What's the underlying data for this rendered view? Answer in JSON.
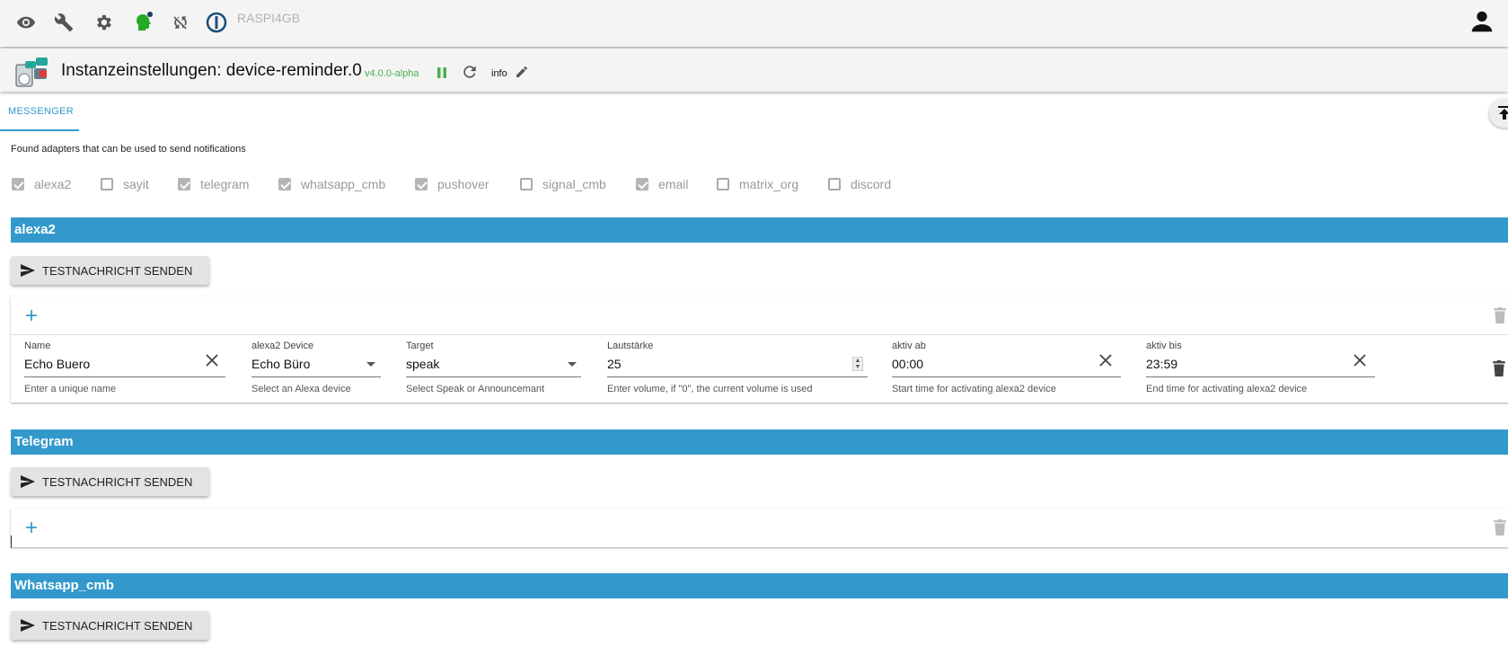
{
  "topbar": {
    "icons": [
      "eye-icon",
      "wrench-icon",
      "gear-icon",
      "head-icon",
      "sync-off-icon",
      "iobroker-logo-icon",
      "account-icon"
    ],
    "host": "RASPI4GB"
  },
  "titlebar": {
    "title": "Instanzeinstellungen: device-reminder.0",
    "version": "v4.0.0-alpha",
    "info": "info"
  },
  "tabs": [
    {
      "label": "MESSENGER"
    }
  ],
  "found_text": "Found adapters that can be used to send notifications",
  "adapters": [
    {
      "label": "alexa2",
      "checked": true
    },
    {
      "label": "sayit",
      "checked": false
    },
    {
      "label": "telegram",
      "checked": true
    },
    {
      "label": "whatsapp_cmb",
      "checked": true
    },
    {
      "label": "pushover",
      "checked": true
    },
    {
      "label": "signal_cmb",
      "checked": false
    },
    {
      "label": "email",
      "checked": true
    },
    {
      "label": "matrix_org",
      "checked": false
    },
    {
      "label": "discord",
      "checked": false
    }
  ],
  "sections": {
    "alexa2": {
      "title": "alexa2",
      "button": "TESTNACHRICHT SENDEN",
      "row": {
        "name": {
          "label": "Name",
          "value": "Echo Buero",
          "help": "Enter a unique name"
        },
        "device": {
          "label": "alexa2 Device",
          "value": "Echo Büro",
          "help": "Select an Alexa device"
        },
        "target": {
          "label": "Target",
          "value": "speak",
          "help": "Select Speak or Announcemant"
        },
        "volume": {
          "label": "Lautstärke",
          "value": "25",
          "help": "Enter volume, if \"0\", the current volume is used"
        },
        "active_from": {
          "label": "aktiv ab",
          "value": "00:00",
          "help": "Start time for activating alexa2 device"
        },
        "active_to": {
          "label": "aktiv bis",
          "value": "23:59",
          "help": "End time for activating alexa2 device"
        }
      }
    },
    "telegram": {
      "title": "Telegram",
      "button": "TESTNACHRICHT SENDEN"
    },
    "whatsapp": {
      "title": "Whatsapp_cmb",
      "button": "TESTNACHRICHT SENDEN"
    }
  },
  "colors": {
    "accent": "#3399cc",
    "running": "#4caf50",
    "head": "#22aa22"
  }
}
